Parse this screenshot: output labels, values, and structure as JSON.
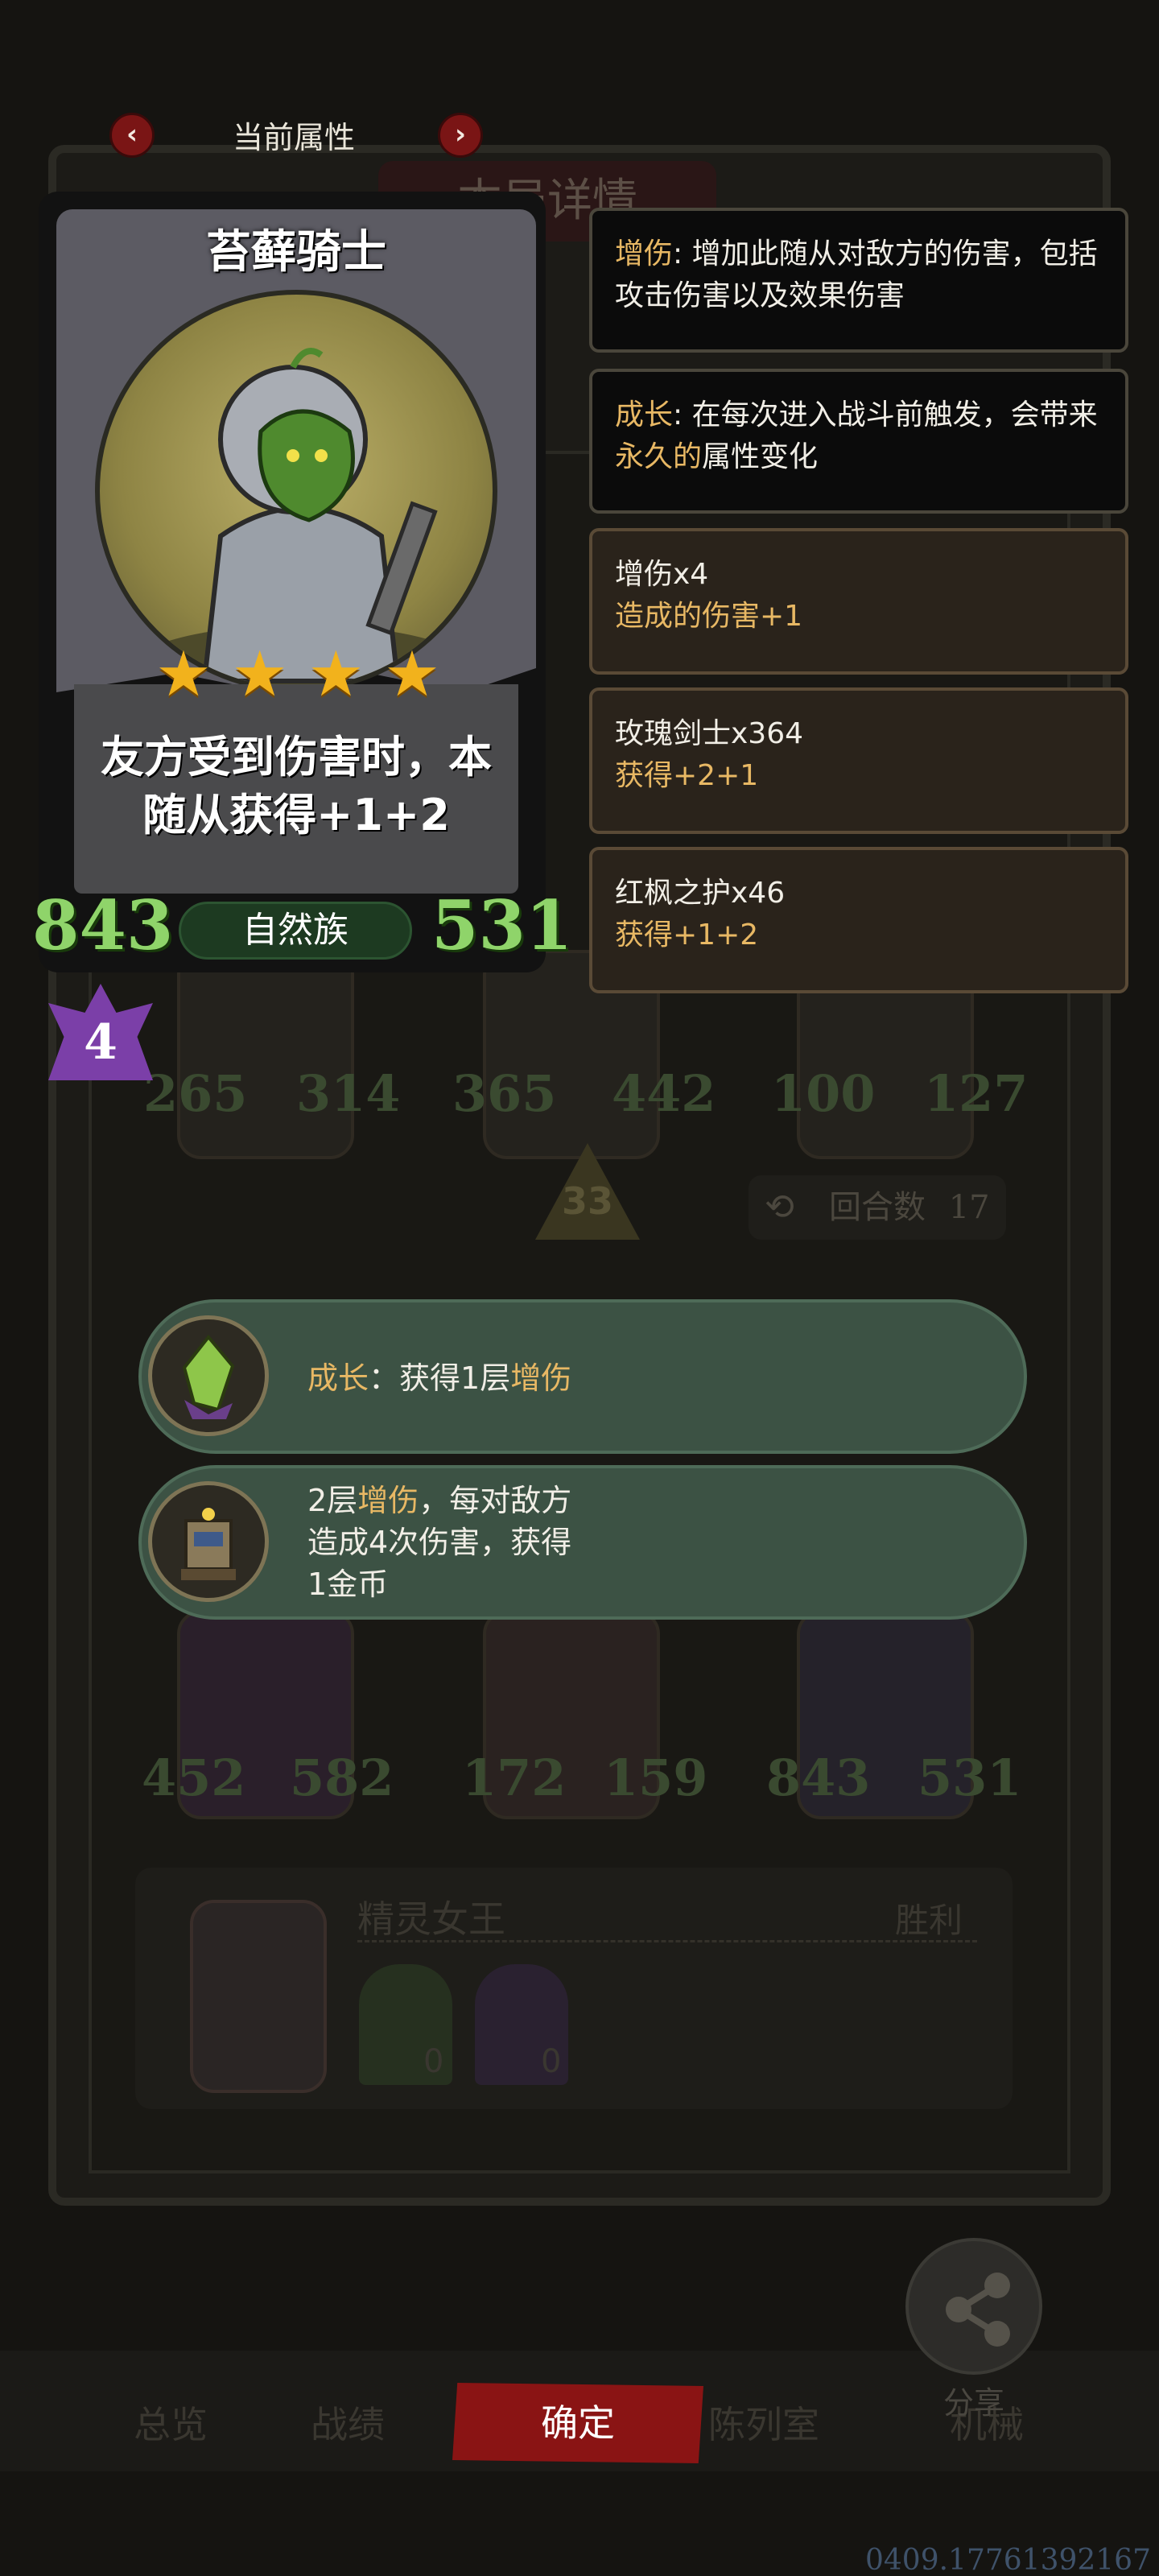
{
  "nav": {
    "prev_icon": "chevron-left-icon",
    "next_icon": "chevron-right-icon",
    "prev_glyph": "‹",
    "next_glyph": "›",
    "title": "当前属性"
  },
  "background": {
    "panel_title": "本局详情",
    "top_row": [
      {
        "atk": "265",
        "hp": "314"
      },
      {
        "atk": "365",
        "hp": "442"
      },
      {
        "atk": "100",
        "hp": "127"
      }
    ],
    "bottom_row": [
      {
        "atk": "452",
        "hp": "582"
      },
      {
        "atk": "172",
        "hp": "159"
      },
      {
        "atk": "843",
        "hp": "531"
      }
    ],
    "tier": "33",
    "round_label": "回合数",
    "round_value": "17",
    "hero_name": "精灵女王",
    "result": "胜利",
    "hero_slots": [
      "0",
      "0"
    ],
    "tabs": [
      "总览",
      "战绩",
      "陈列室",
      "机械"
    ]
  },
  "card": {
    "name": "苔藓骑士",
    "stars": [
      "★",
      "★",
      "★",
      "★"
    ],
    "description_line1": "友方受到伤害时，本",
    "description_line2": "随从获得+1+2",
    "attack": "843",
    "health": "531",
    "tribe": "自然族",
    "level": "4"
  },
  "tooltips": [
    {
      "keyword": "增伤",
      "text": ": 增加此随从对敌方的伤害，包括攻击伤害以及效果伤害"
    },
    {
      "keyword": "成长",
      "text_before": ": 在每次进入战斗前触发，会带来",
      "highlight": "永久的",
      "text_after": "属性变化"
    }
  ],
  "buffs": [
    {
      "title": "增伤x4",
      "effect": "造成的伤害+1"
    },
    {
      "title": "玫瑰剑士x364",
      "effect": "获得+2+1"
    },
    {
      "title": "红枫之护x46",
      "effect": "获得+1+2"
    }
  ],
  "bubbles": [
    {
      "keyword": "成长",
      "sep": "：获得1层",
      "highlight": "增伤"
    },
    {
      "prefix": "2层",
      "highlight": "增伤",
      "line1_rest": "，每对敌方",
      "line2": "造成4次伤害，获得",
      "line3": "1金币"
    }
  ],
  "bottom": {
    "confirm_label": "确定",
    "share_label": "分享",
    "share_icon": "share-icon",
    "footer_id": "0409.17761392167"
  },
  "colors": {
    "keyword_gold": "#e8b864",
    "stat_green": "#8fd46a",
    "confirm_red": "#8a1414",
    "tribe_green": "#1d3a21",
    "bubble_teal": "#3c5244"
  }
}
